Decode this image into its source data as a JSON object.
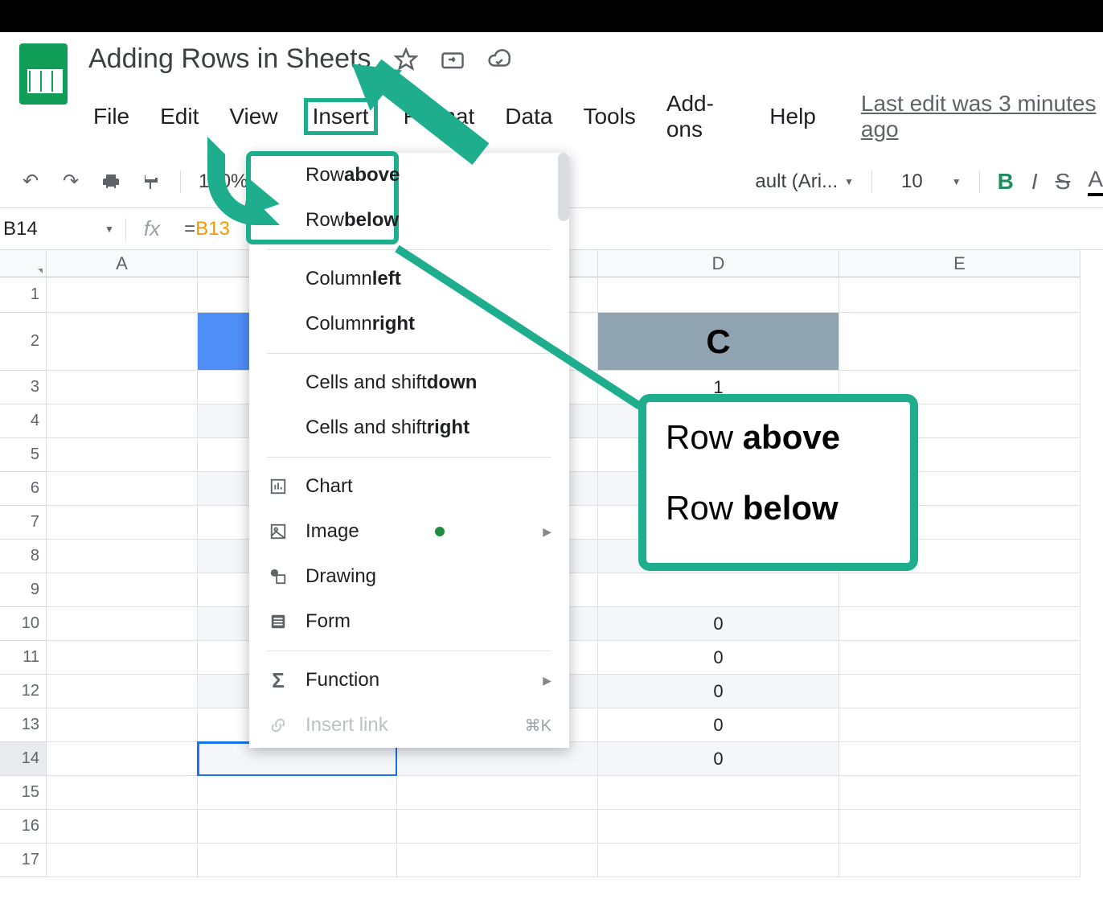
{
  "doc": {
    "title": "Adding Rows in Sheets"
  },
  "menus": {
    "file": "File",
    "edit": "Edit",
    "view": "View",
    "insert": "Insert",
    "format": "Format",
    "data": "Data",
    "tools": "Tools",
    "addons": "Add-ons",
    "help": "Help",
    "last_edit": "Last edit was 3 minutes ago"
  },
  "toolbar": {
    "zoom": "100%",
    "font_prefix": "ault (Ari...",
    "font_size": "10",
    "bold": "B",
    "italic": "I",
    "strike": "S",
    "color": "A"
  },
  "formula": {
    "cell_ref": "B14",
    "fx": "fx",
    "value_prefix": "=",
    "value_ref": "B13"
  },
  "columns": {
    "A": "A",
    "D": "D",
    "E": "E"
  },
  "rows": [
    "1",
    "2",
    "3",
    "4",
    "5",
    "6",
    "7",
    "8",
    "9",
    "10",
    "11",
    "12",
    "13",
    "14",
    "15",
    "16",
    "17"
  ],
  "data": {
    "D2": "C",
    "D3": "1",
    "D10": "0",
    "D11": "0",
    "D12": "0",
    "D13": "0",
    "D14": "0"
  },
  "insert_menu": {
    "row_above_pre": "Row ",
    "row_above_b": "above",
    "row_below_pre": "Row ",
    "row_below_b": "below",
    "col_left_pre": "Column ",
    "col_left_b": "left",
    "col_right_pre": "Column ",
    "col_right_b": "right",
    "cells_down_pre": "Cells and shift ",
    "cells_down_b": "down",
    "cells_right_pre": "Cells and shift ",
    "cells_right_b": "right",
    "chart": "Chart",
    "image": "Image",
    "drawing": "Drawing",
    "form": "Form",
    "function": "Function",
    "insert_link": "Insert link",
    "link_shortcut": "⌘K"
  },
  "callout": {
    "line1_pre": "Row ",
    "line1_b": "above",
    "line2_pre": "Row ",
    "line2_b": "below"
  }
}
